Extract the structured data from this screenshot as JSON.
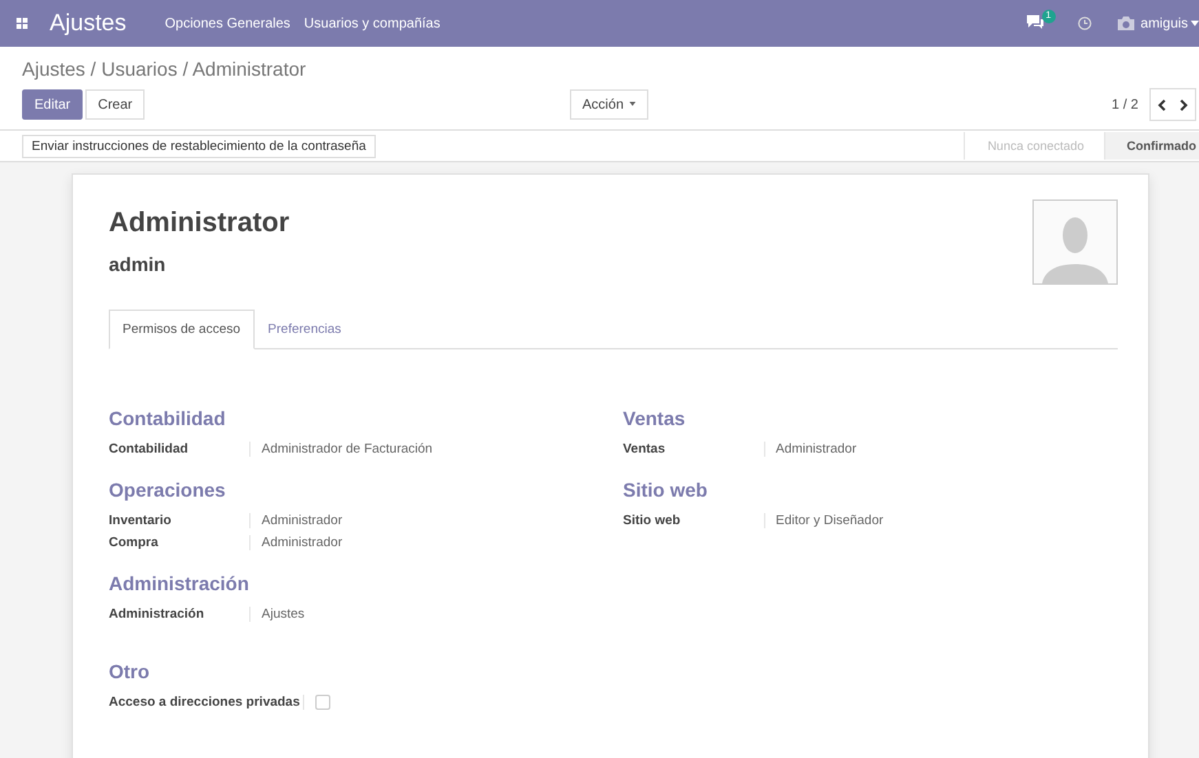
{
  "navbar": {
    "app": "Ajustes",
    "menu": [
      "Opciones Generales",
      "Usuarios y compañías"
    ],
    "messages_badge": "1",
    "user": "amiguis"
  },
  "breadcrumb": "Ajustes / Usuarios / Administrator",
  "buttons": [
    {
      "label": "Editar",
      "kind": "primary"
    },
    {
      "label": "Crear",
      "kind": "secondary"
    }
  ],
  "action": "Acción",
  "pager": "1 / 2",
  "header_button": "Enviar instrucciones de restablecimiento de la contraseña",
  "stages": [
    {
      "label": "Nunca conectado",
      "selected": false
    },
    {
      "label": "Confirmado",
      "selected": true
    }
  ],
  "record": {
    "name": "Administrator",
    "login": "admin"
  },
  "tabs": [
    {
      "label": "Permisos de acceso",
      "selected": true
    },
    {
      "label": "Preferencias",
      "selected": false
    }
  ],
  "columns": [
    [
      {
        "title": "Contabilidad",
        "fields": [
          {
            "label": "Contabilidad",
            "kind": "text",
            "value": "Administrador de Facturación"
          }
        ]
      },
      {
        "title": "Operaciones",
        "fields": [
          {
            "label": "Inventario",
            "kind": "text",
            "value": "Administrador"
          },
          {
            "label": "Compra",
            "kind": "text",
            "value": "Administrador"
          }
        ]
      },
      {
        "title": "Administración",
        "fields": [
          {
            "label": "Administración",
            "kind": "text",
            "value": "Ajustes"
          }
        ]
      },
      {
        "title": "Otro",
        "fields": [
          {
            "label": "Acceso a direcciones privadas",
            "kind": "checkbox",
            "checked": false
          }
        ]
      }
    ],
    [
      {
        "title": "Ventas",
        "fields": [
          {
            "label": "Ventas",
            "kind": "text",
            "value": "Administrador"
          }
        ]
      },
      {
        "title": "Sitio web",
        "fields": [
          {
            "label": "Sitio web",
            "kind": "text",
            "value": "Editor y Diseñador"
          }
        ]
      }
    ]
  ]
}
